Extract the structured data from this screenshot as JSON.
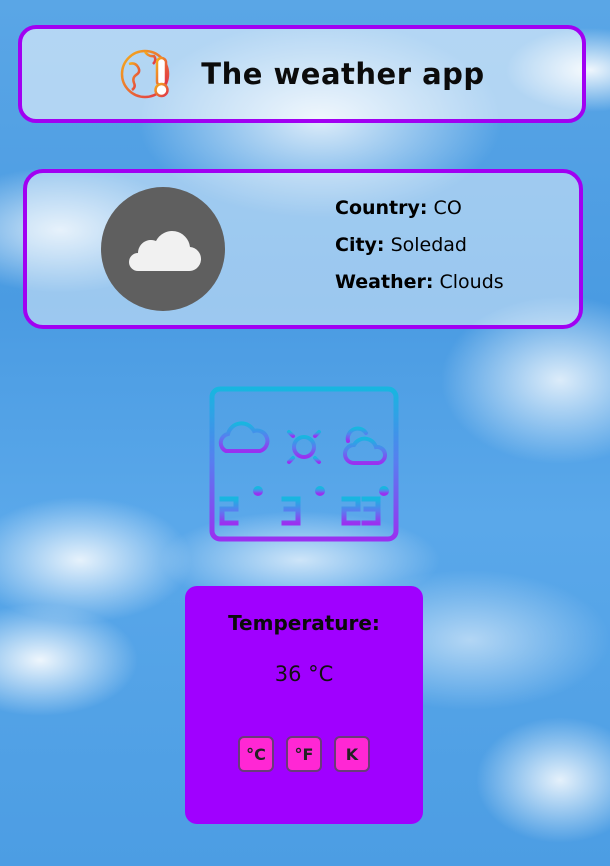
{
  "header": {
    "title": "The weather app",
    "icon": "globe-thermometer-icon"
  },
  "weather_info": {
    "condition_icon": "cloud-icon",
    "country_label": "Country:",
    "country_value": "CO",
    "city_label": "City:",
    "city_value": "Soledad",
    "weather_label": "Weather:",
    "weather_value": "Clouds"
  },
  "forecast_illustration": {
    "icon": "weather-calendar-icon",
    "days": [
      {
        "icon": "rain-cloud-icon",
        "value": "21°"
      },
      {
        "icon": "sun-icon",
        "value": "31°"
      },
      {
        "icon": "partly-cloudy-icon",
        "value": "23°"
      }
    ]
  },
  "temperature": {
    "label": "Temperature:",
    "value": "36 °C",
    "units": [
      "°C",
      "°F",
      "K"
    ]
  },
  "colors": {
    "accent": "#a100f2",
    "temp_card": "#a000ff",
    "unit_button": "#ff27d4",
    "cloud_circle": "#5f5f5f"
  }
}
